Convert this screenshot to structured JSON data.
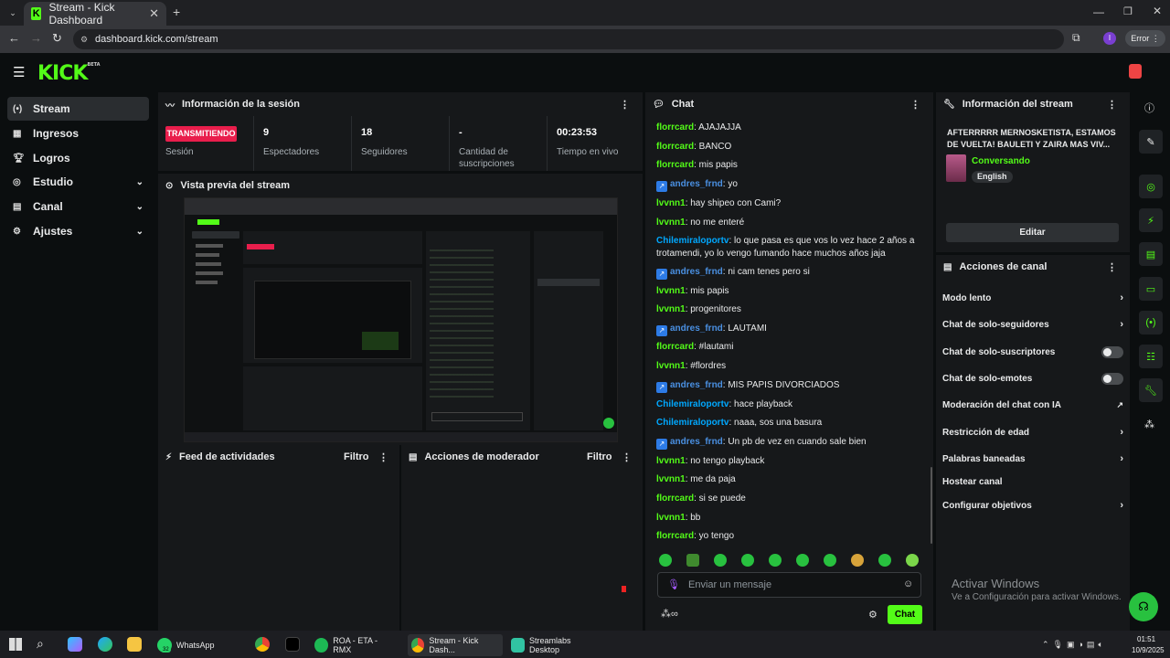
{
  "browser": {
    "tab_title": "Stream - Kick Dashboard",
    "url": "dashboard.kick.com/stream",
    "error_label": "Error",
    "profile_initial": "I"
  },
  "app": {
    "logo": "KICK",
    "logo_tag": "BETA"
  },
  "sidebar": {
    "items": [
      {
        "label": "Stream",
        "icon": "stream-icon"
      },
      {
        "label": "Ingresos",
        "icon": "money-icon"
      },
      {
        "label": "Logros",
        "icon": "trophy-icon"
      },
      {
        "label": "Estudio",
        "icon": "studio-icon"
      },
      {
        "label": "Canal",
        "icon": "channel-icon"
      },
      {
        "label": "Ajustes",
        "icon": "gear-icon"
      }
    ]
  },
  "session": {
    "title": "Información de la sesión",
    "status": "TRANSMITIENDO",
    "status_label": "Sesión",
    "stats": [
      {
        "value": "9",
        "label": "Espectadores"
      },
      {
        "value": "18",
        "label": "Seguidores"
      },
      {
        "value": "-",
        "label": "Cantidad de suscripciones"
      },
      {
        "value": "00:23:53",
        "label": "Tiempo en vivo"
      }
    ]
  },
  "preview": {
    "title": "Vista previa del stream"
  },
  "activity_feed": {
    "title": "Feed de actividades",
    "filter": "Filtro"
  },
  "mod_actions": {
    "title": "Acciones de moderador",
    "filter": "Filtro"
  },
  "chat": {
    "title": "Chat",
    "messages": [
      {
        "user": "florrcard",
        "text": ": AJAJAJJA",
        "color": "green",
        "badge": false
      },
      {
        "user": "florrcard",
        "text": ": BANCO",
        "color": "green",
        "badge": false
      },
      {
        "user": "florrcard",
        "text": ": mis papis",
        "color": "green",
        "badge": false
      },
      {
        "user": "andres_frnd",
        "text": ": yo",
        "color": "blue",
        "badge": true
      },
      {
        "user": "lvvnn1",
        "text": ": hay shipeo con Cami?",
        "color": "green",
        "badge": false
      },
      {
        "user": "lvvnn1",
        "text": ": no me enteré",
        "color": "green",
        "badge": false
      },
      {
        "user": "Chilemiraloportv",
        "text": ": lo que pasa es que vos lo vez hace 2 años a trotamendi, yo lo vengo fumando hace muchos años jaja",
        "color": "cyan",
        "badge": false
      },
      {
        "user": "andres_frnd",
        "text": ": ni cam tenes pero si",
        "color": "blue",
        "badge": true
      },
      {
        "user": "lvvnn1",
        "text": ": mis papis",
        "color": "green",
        "badge": false
      },
      {
        "user": "lvvnn1",
        "text": ": progenitores",
        "color": "green",
        "badge": false
      },
      {
        "user": "andres_frnd",
        "text": ": LAUTAMI",
        "color": "blue",
        "badge": true
      },
      {
        "user": "florrcard",
        "text": ": #lautami",
        "color": "green",
        "badge": false
      },
      {
        "user": "lvvnn1",
        "text": ": #flordres",
        "color": "green",
        "badge": false
      },
      {
        "user": "andres_frnd",
        "text": ": MIS PAPIS DIVORCIADOS",
        "color": "blue",
        "badge": true
      },
      {
        "user": "Chilemiraloportv",
        "text": ": hace playback",
        "color": "cyan",
        "badge": false
      },
      {
        "user": "Chilemiraloportv",
        "text": ": naaa, sos una basura",
        "color": "cyan",
        "badge": false
      },
      {
        "user": "andres_frnd",
        "text": ": Un pb de vez en cuando sale bien",
        "color": "blue",
        "badge": true
      },
      {
        "user": "lvvnn1",
        "text": ": no tengo playback",
        "color": "green",
        "badge": false
      },
      {
        "user": "lvvnn1",
        "text": ": me da paja",
        "color": "green",
        "badge": false
      },
      {
        "user": "florrcard",
        "text": ": si se puede",
        "color": "green",
        "badge": false
      },
      {
        "user": "lvvnn1",
        "text": ": bb",
        "color": "green",
        "badge": false
      },
      {
        "user": "florrcard",
        "text": ": yo tengo",
        "color": "green",
        "badge": false
      }
    ],
    "input_placeholder": "Enviar un mensaje",
    "send_label": "Chat"
  },
  "stream_info": {
    "title": "Información del stream",
    "stream_title": "AFTERRRRR MERNOSKETISTA, ESTAMOS DE VUELTA! BAULETI Y ZAIRA MAS VIV...",
    "category": "Conversando",
    "language": "English",
    "edit_label": "Editar"
  },
  "channel_actions": {
    "title": "Acciones de canal",
    "items": [
      {
        "label": "Modo lento",
        "control": "chevron"
      },
      {
        "label": "Chat de solo-seguidores",
        "control": "chevron"
      },
      {
        "label": "Chat de solo-suscriptores",
        "control": "toggle"
      },
      {
        "label": "Chat de solo-emotes",
        "control": "toggle"
      },
      {
        "label": "Moderación del chat con IA",
        "control": "external"
      },
      {
        "label": "Restricción de edad",
        "control": "chevron"
      },
      {
        "label": "Palabras baneadas",
        "control": "chevron"
      },
      {
        "label": "Hostear canal",
        "control": "none"
      },
      {
        "label": "Configurar objetivos",
        "control": "chevron"
      }
    ]
  },
  "watermark": {
    "title": "Activar Windows",
    "subtitle": "Ve a Configuración para activar Windows."
  },
  "taskbar": {
    "apps": [
      {
        "label": "WhatsApp",
        "color": "#25d366"
      },
      {
        "label": "ROA - ETA - RMX",
        "color": "#1db954"
      },
      {
        "label": "Stream - Kick Dash...",
        "color": "#53fc18"
      },
      {
        "label": "Streamlabs Desktop",
        "color": "#31c3a2"
      }
    ],
    "whatsapp_badge": "32",
    "time": "01:51",
    "date": "10/9/2025"
  },
  "colors": {
    "accent": "#53fc18",
    "live": "#e91e4c",
    "panel": "#16181a",
    "background": "#0b0e0f"
  }
}
